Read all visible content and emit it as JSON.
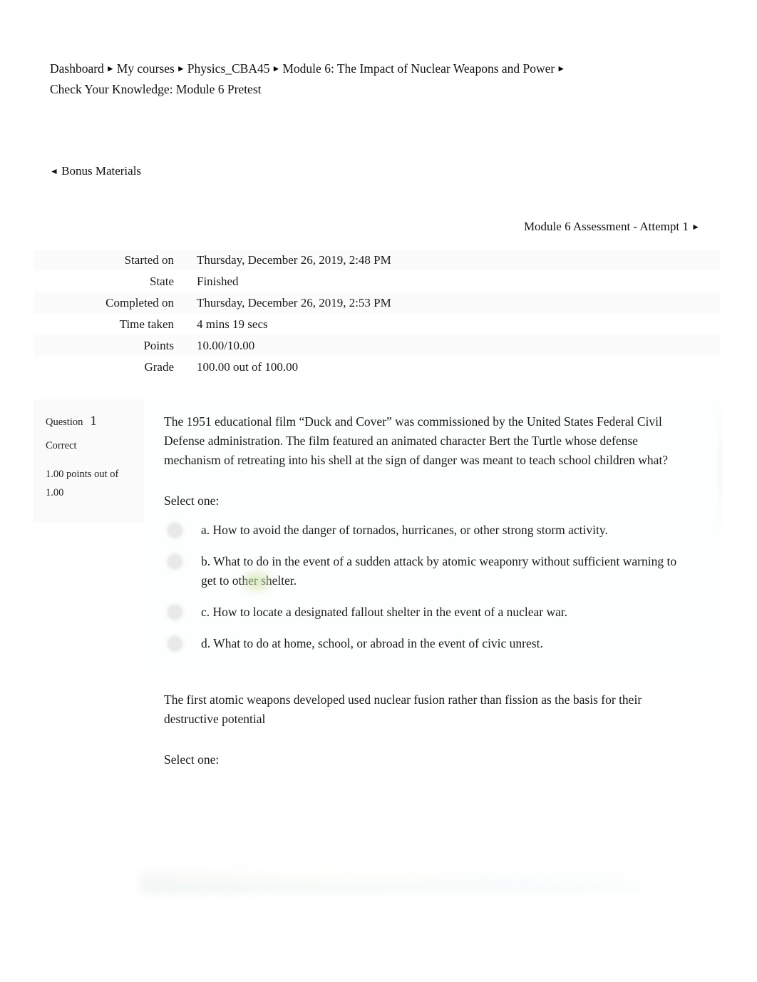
{
  "breadcrumb": {
    "separator": "►",
    "items": [
      {
        "label": "Dashboard"
      },
      {
        "label": "My courses"
      },
      {
        "label": "Physics_CBA45"
      },
      {
        "label": "Module 6: The Impact of Nuclear Weapons and Power"
      },
      {
        "label": "Check Your Knowledge: Module 6 Pretest"
      }
    ]
  },
  "nav": {
    "prev_arrow": "◄",
    "prev_label": "Bonus Materials",
    "next_label": "Module 6 Assessment - Attempt 1",
    "next_arrow": "►"
  },
  "summary": {
    "rows": [
      {
        "label": "Started on",
        "value": "Thursday, December 26, 2019, 2:48 PM"
      },
      {
        "label": "State",
        "value": "Finished"
      },
      {
        "label": "Completed on",
        "value": "Thursday, December 26, 2019, 2:53 PM"
      },
      {
        "label": "Time taken",
        "value": "4 mins 19 secs"
      },
      {
        "label": "Points",
        "value": "10.00/10.00"
      },
      {
        "label": "Grade",
        "value": "100.00  out of 100.00"
      }
    ]
  },
  "question1": {
    "info": {
      "question_label": "Question",
      "question_number": "1",
      "state": "Correct",
      "grade_line1": "1.00 points out of",
      "grade_line2": "1.00"
    },
    "text": "The 1951 educational film “Duck and Cover” was commissioned by the United States Federal Civil Defense administration. The film featured an animated character Bert the Turtle whose defense mechanism of retreating into his shell at the sign of danger was meant to teach school children what?",
    "select_prompt": "Select one:",
    "options": [
      {
        "text": "a. How to avoid the danger of tornados, hurricanes, or other strong storm activity."
      },
      {
        "text": "b. What to do in the event of a sudden attack by atomic weaponry without sufficient warning to get to other shelter."
      },
      {
        "text": "c. How to locate a designated fallout shelter in the event of a nuclear war."
      },
      {
        "text": "d. What to do at home, school, or abroad in the event of civic unrest."
      }
    ]
  },
  "question2": {
    "text": "The first atomic weapons developed used nuclear fusion rather than fission as the basis for their destructive potential",
    "select_prompt": "Select one:"
  },
  "colors": {
    "page_background": "#ffffff",
    "text": "#1a1a1a",
    "summary_row_alt": "#fbfbfb",
    "question_info_background": "#fafafa",
    "correct_highlight": "#bedb96"
  }
}
